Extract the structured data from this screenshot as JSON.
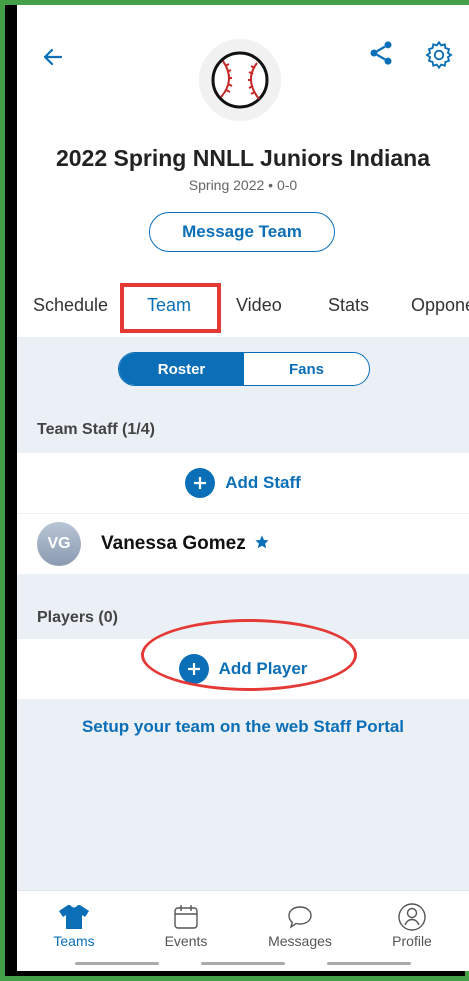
{
  "header": {
    "team_name": "2022 Spring NNLL Juniors Indiana",
    "team_sub": "Spring 2022 • 0-0",
    "message_button": "Message Team"
  },
  "tabs": [
    {
      "label": "Schedule"
    },
    {
      "label": "Team",
      "active": true
    },
    {
      "label": "Video"
    },
    {
      "label": "Stats"
    },
    {
      "label": "Oppone"
    }
  ],
  "segment": {
    "roster": "Roster",
    "fans": "Fans"
  },
  "staff": {
    "section_label": "Team Staff (1/4)",
    "add_label": "Add Staff",
    "members": [
      {
        "initials": "VG",
        "name": "Vanessa Gomez"
      }
    ]
  },
  "players": {
    "section_label": "Players (0)",
    "add_label": "Add Player"
  },
  "portal_link": "Setup your team on the web Staff Portal",
  "bottom_nav": [
    {
      "label": "Teams",
      "icon": "jersey-icon",
      "active": true
    },
    {
      "label": "Events",
      "icon": "calendar-icon"
    },
    {
      "label": "Messages",
      "icon": "chat-bubble-icon"
    },
    {
      "label": "Profile",
      "icon": "profile-icon"
    }
  ],
  "colors": {
    "accent": "#0b6fb8",
    "annotation": "#e53935",
    "frame": "#43a047"
  }
}
